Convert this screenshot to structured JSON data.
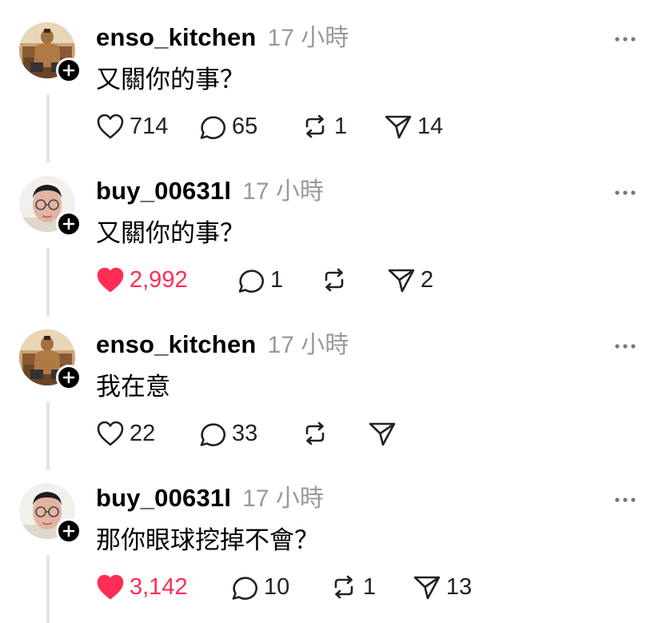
{
  "colors": {
    "liked": "#ff2d55",
    "timestamp": "#999999",
    "thread_line": "#e5e5e5"
  },
  "posts": [
    {
      "username": "enso_kitchen",
      "timestamp": "17 小時",
      "text": "又關你的事？",
      "avatar_icon": "avatar-enso-kitchen",
      "liked": false,
      "likes": "714",
      "comments": "65",
      "reposts": "1",
      "shares": "14"
    },
    {
      "username": "buy_00631l",
      "timestamp": "17 小時",
      "text": "又關你的事？",
      "avatar_icon": "avatar-buy-00631l",
      "liked": true,
      "likes": "2,992",
      "comments": "1",
      "reposts": "",
      "shares": "2"
    },
    {
      "username": "enso_kitchen",
      "timestamp": "17 小時",
      "text": "我在意",
      "avatar_icon": "avatar-enso-kitchen",
      "liked": false,
      "likes": "22",
      "comments": "33",
      "reposts": "",
      "shares": ""
    },
    {
      "username": "buy_00631l",
      "timestamp": "17 小時",
      "text": "那你眼球挖掉不會？",
      "avatar_icon": "avatar-buy-00631l",
      "liked": true,
      "likes": "3,142",
      "comments": "10",
      "reposts": "1",
      "shares": "13"
    }
  ]
}
